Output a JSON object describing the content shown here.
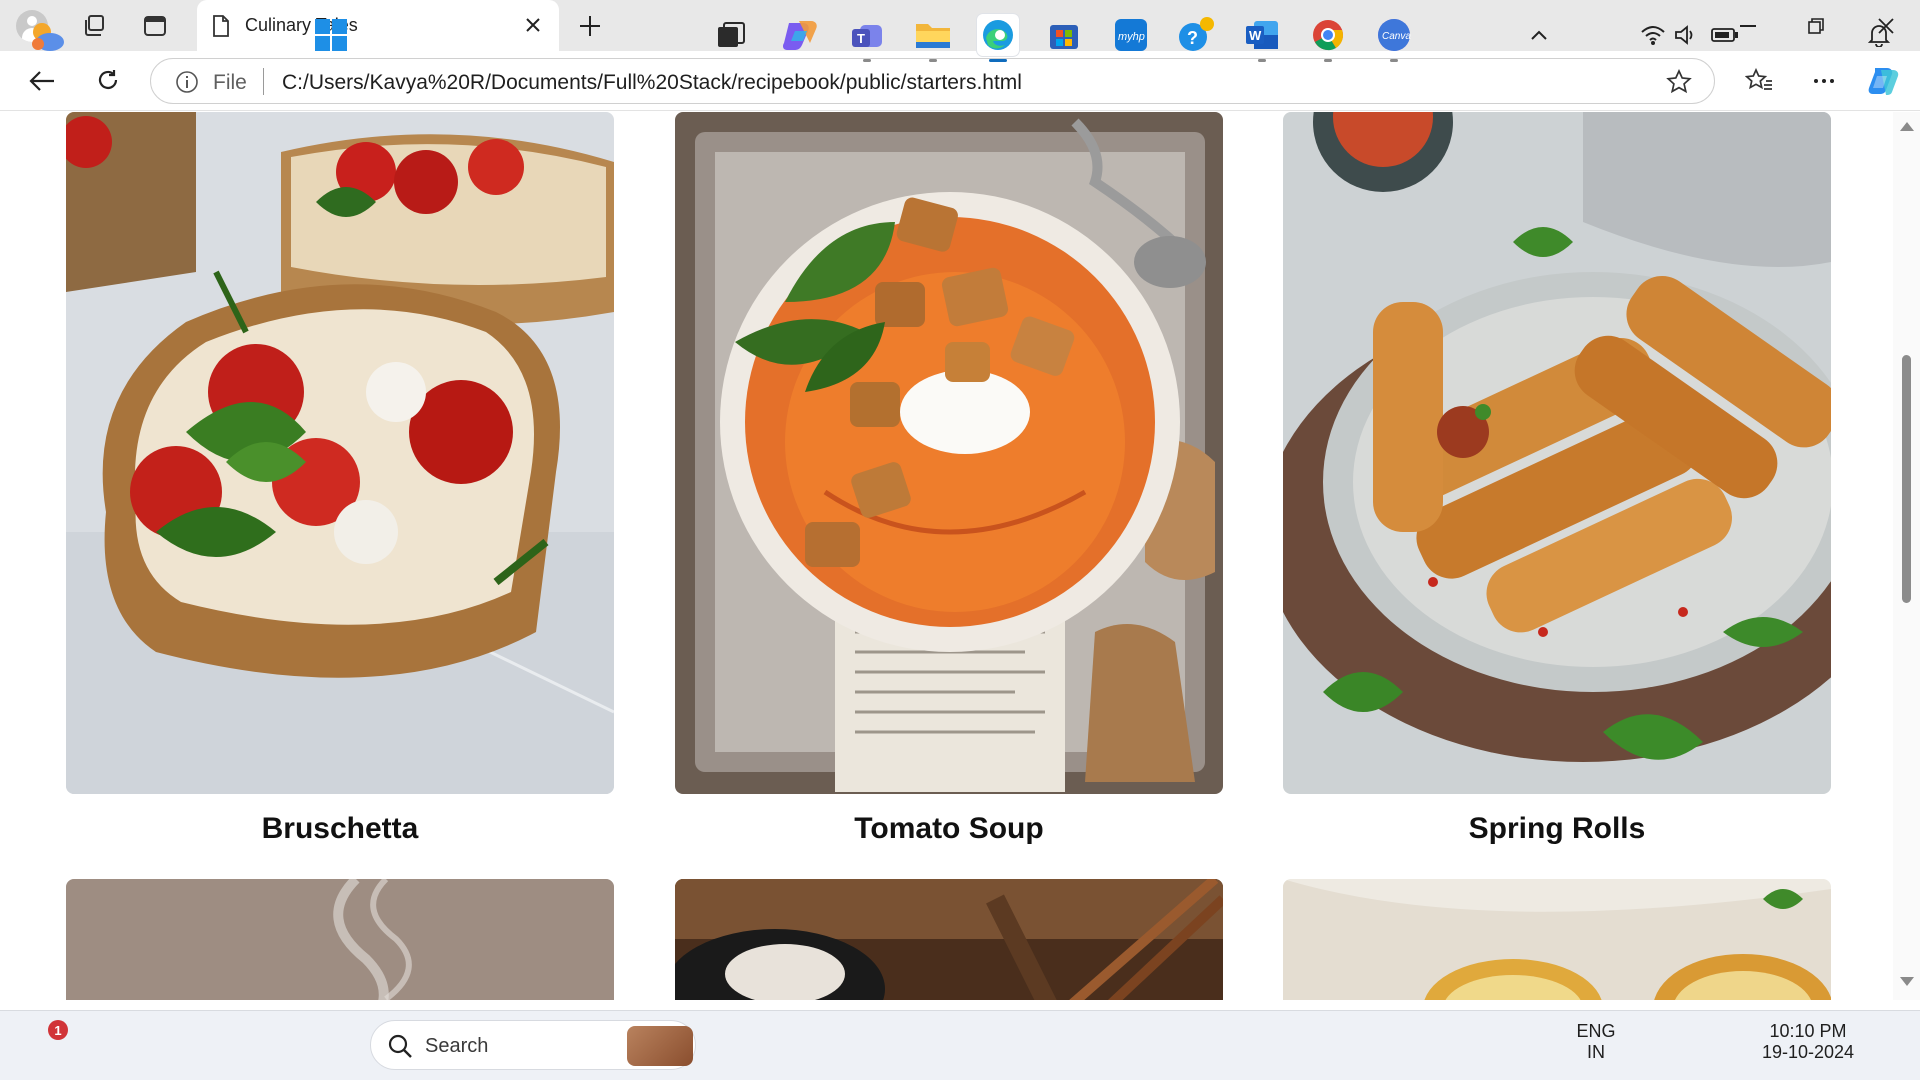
{
  "browser": {
    "tab_title": "Culinary Tales",
    "address_prefix": "File",
    "url": "C:/Users/Kavya%20R/Documents/Full%20Stack/recipebook/public/starters.html"
  },
  "page": {
    "cards": [
      {
        "name": "Bruschetta"
      },
      {
        "name": "Tomato Soup"
      },
      {
        "name": "Spring Rolls"
      }
    ]
  },
  "taskbar": {
    "search_label": "Search",
    "notification_count": "1",
    "language_line1": "ENG",
    "language_line2": "IN",
    "time": "10:10 PM",
    "date": "19-10-2024"
  },
  "colors": {
    "accent": "#0f6cbd",
    "titlebar_bg": "#e8e8e8",
    "taskbar_bg": "#eef1f6"
  }
}
